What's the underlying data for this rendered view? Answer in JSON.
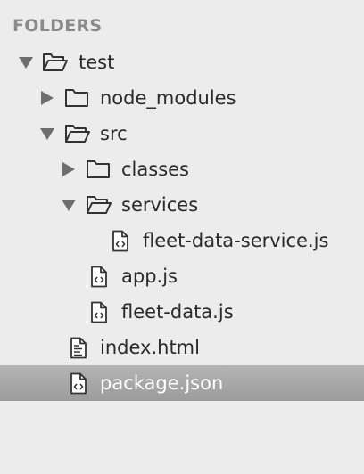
{
  "sidebar": {
    "header": "FOLDERS",
    "items": [
      {
        "label": "test",
        "kind": "folder-open",
        "depth": 0,
        "expanded": true
      },
      {
        "label": "node_modules",
        "kind": "folder-closed",
        "depth": 1,
        "expanded": false
      },
      {
        "label": "src",
        "kind": "folder-open",
        "depth": 1,
        "expanded": true
      },
      {
        "label": "classes",
        "kind": "folder-closed",
        "depth": 2,
        "expanded": false
      },
      {
        "label": "services",
        "kind": "folder-open",
        "depth": 2,
        "expanded": true
      },
      {
        "label": "fleet-data-service.js",
        "kind": "code-file",
        "depth": 3
      },
      {
        "label": "app.js",
        "kind": "code-file",
        "depth": 2
      },
      {
        "label": "fleet-data.js",
        "kind": "code-file",
        "depth": 2
      },
      {
        "label": "index.html",
        "kind": "text-file",
        "depth": 1
      },
      {
        "label": "package.json",
        "kind": "code-file",
        "depth": 1,
        "selected": true
      }
    ]
  },
  "colors": {
    "background": "#ececec",
    "header_text": "#8a8a8a",
    "selection": "#a8a8a8",
    "icon_stroke": "#333333",
    "arrow": "#6e6e6e"
  }
}
